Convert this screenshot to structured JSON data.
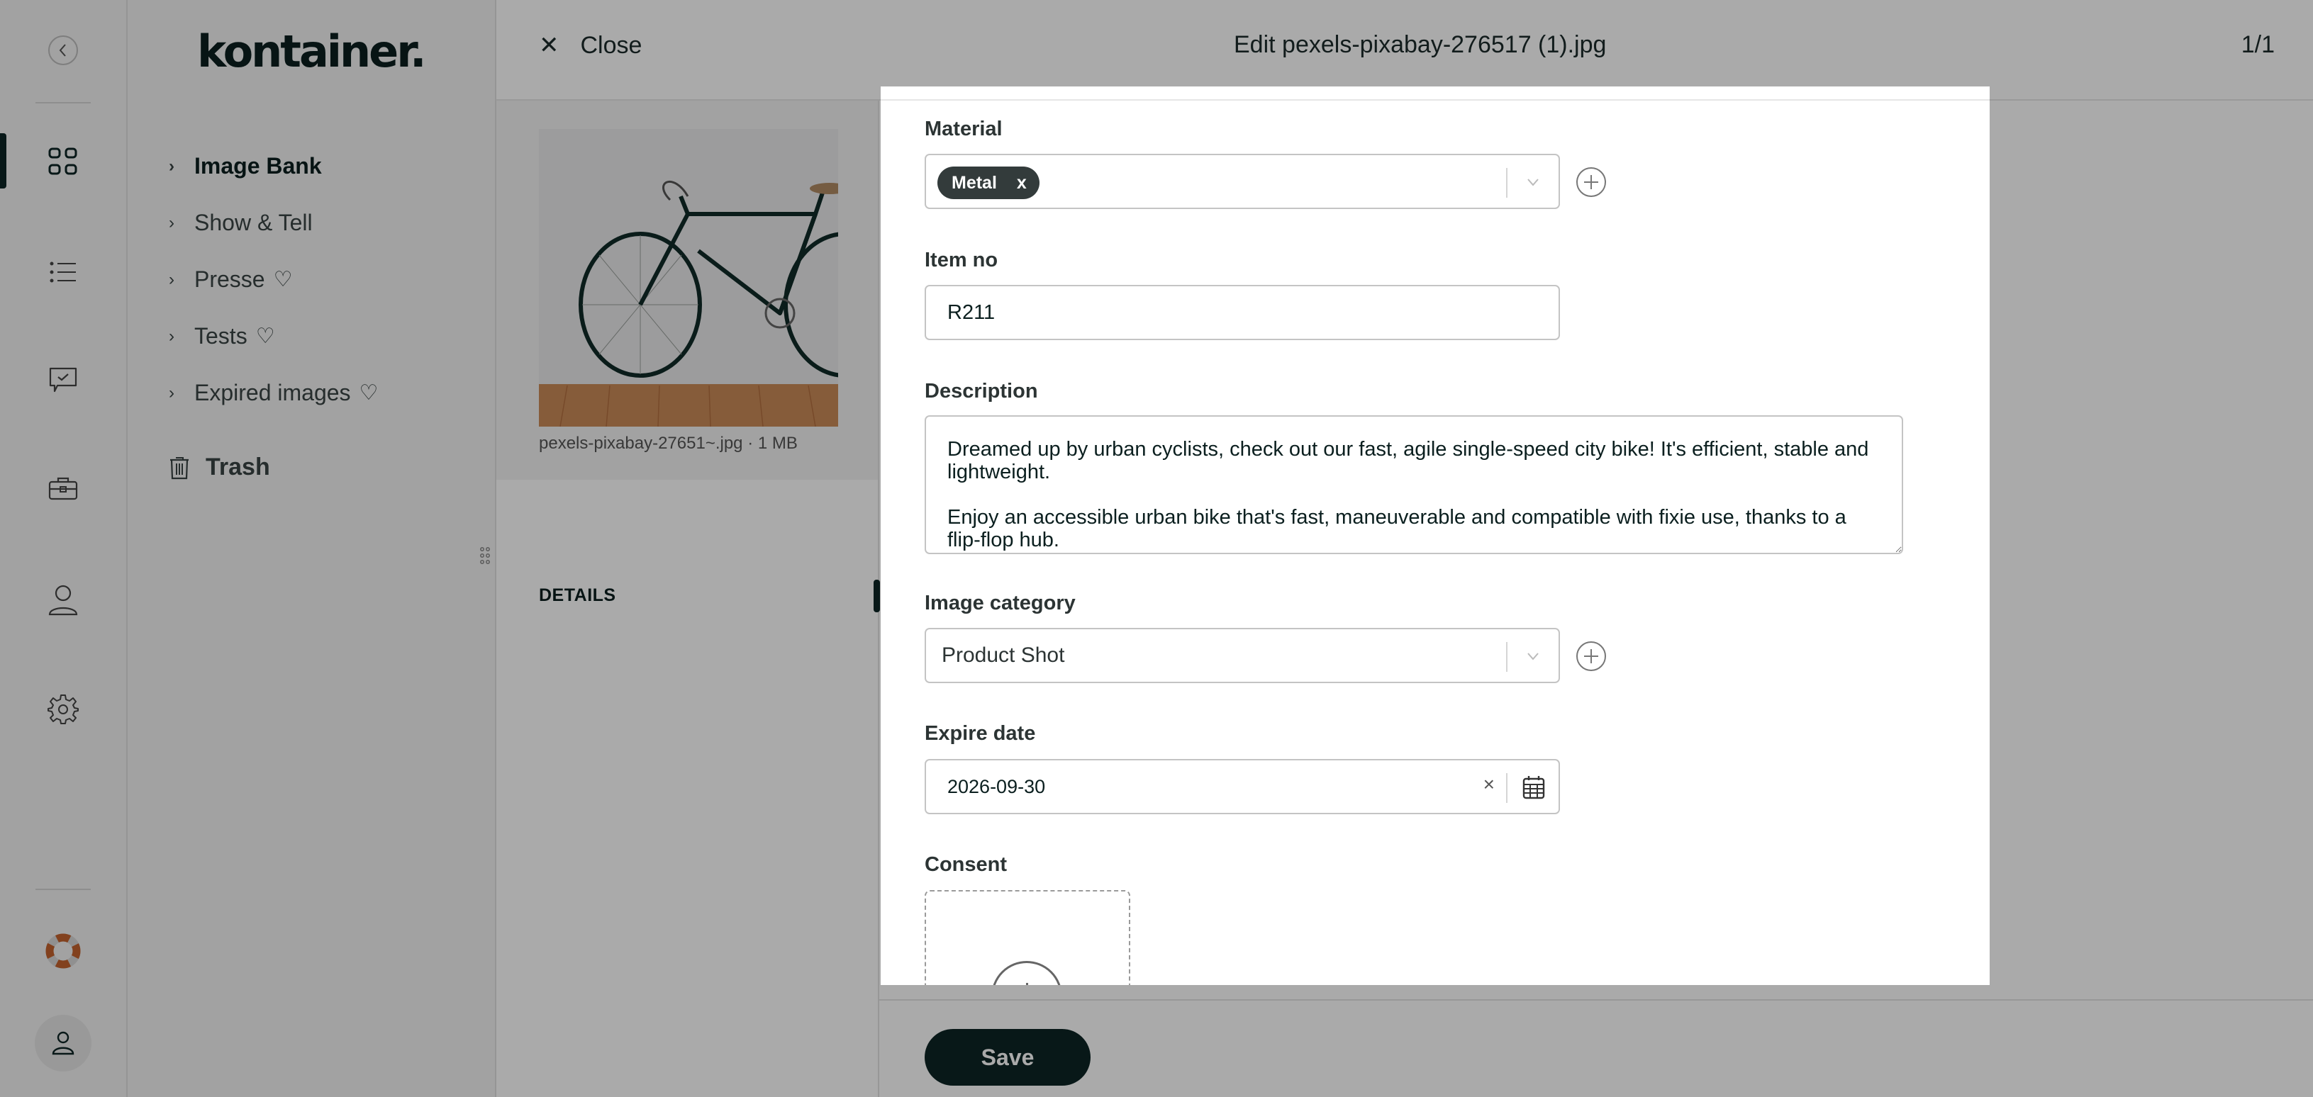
{
  "app": {
    "logo": "kontainer."
  },
  "rail": {
    "items": [
      {
        "name": "collapse",
        "icon": "chevron-left-icon"
      },
      {
        "name": "grid",
        "icon": "grid-icon",
        "active": true
      },
      {
        "name": "list",
        "icon": "list-icon"
      },
      {
        "name": "approvals",
        "icon": "chat-check-icon"
      },
      {
        "name": "portfolio",
        "icon": "briefcase-icon"
      },
      {
        "name": "users",
        "icon": "user-icon"
      },
      {
        "name": "settings",
        "icon": "gear-icon"
      },
      {
        "name": "help",
        "icon": "lifebuoy-icon"
      },
      {
        "name": "account",
        "icon": "avatar-icon"
      }
    ]
  },
  "nav": {
    "items": [
      {
        "label": "Image Bank",
        "bold": true,
        "heart": false
      },
      {
        "label": "Show & Tell",
        "bold": false,
        "heart": false
      },
      {
        "label": "Presse",
        "bold": false,
        "heart": true
      },
      {
        "label": "Tests",
        "bold": false,
        "heart": true
      },
      {
        "label": "Expired images",
        "bold": false,
        "heart": true
      }
    ],
    "trash_label": "Trash",
    "heart_glyph": "♡"
  },
  "header": {
    "close_label": "Close",
    "title": "Edit pexels-pixabay-276517 (1).jpg",
    "counter": "1/1"
  },
  "preview": {
    "caption": "pexels-pixabay-27651~.jpg · 1 MB",
    "details_label": "DETAILS"
  },
  "form": {
    "material": {
      "label": "Material",
      "chips": [
        "Metal"
      ],
      "chip_remove": "x"
    },
    "item_no": {
      "label": "Item no",
      "value": "R211"
    },
    "description": {
      "label": "Description",
      "value": "Dreamed up by urban cyclists, check out our fast, agile single-speed city bike! It's efficient, stable and lightweight.\n\nEnjoy an accessible urban bike that's fast, maneuverable and compatible with fixie use, thanks to a flip-flop hub."
    },
    "image_category": {
      "label": "Image category",
      "value": "Product Shot"
    },
    "expire_date": {
      "label": "Expire date",
      "value": "2026-09-30",
      "clear": "×"
    },
    "consent": {
      "label": "Consent"
    }
  },
  "footer": {
    "save_label": "Save"
  },
  "colors": {
    "brand_dark": "#0d2424",
    "chip_bg": "#333b3b",
    "help_icon": "#8b4a2b",
    "overlay": "rgba(0,0,0,0.335)"
  }
}
